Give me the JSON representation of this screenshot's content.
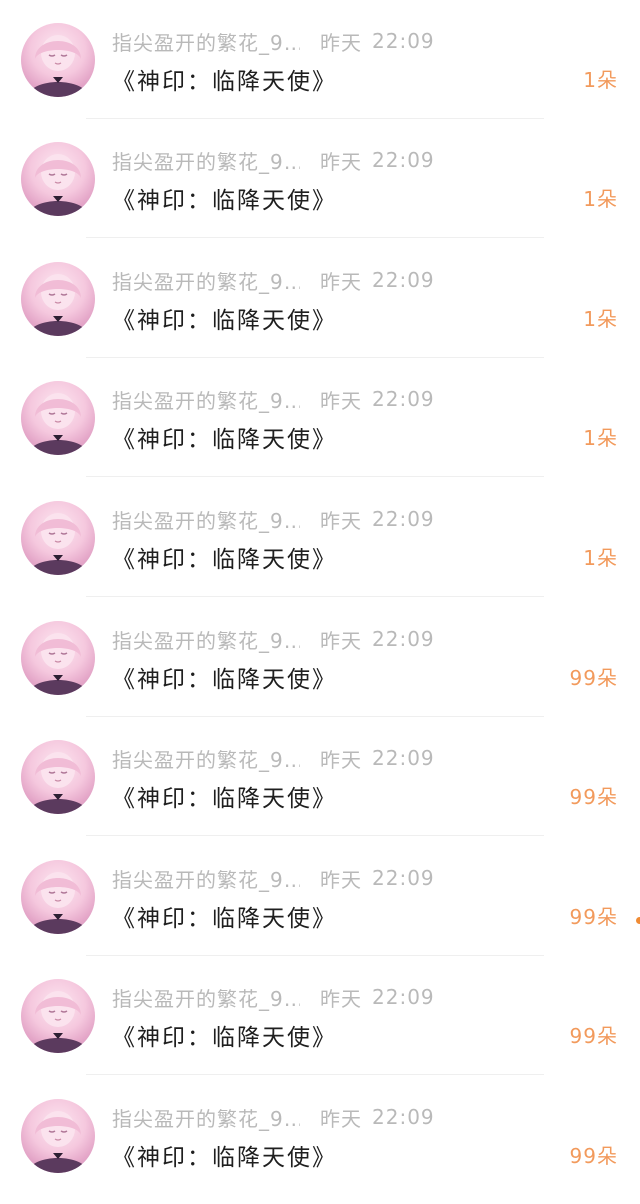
{
  "accent_color": "#f29a5c",
  "items": [
    {
      "sender": "指尖盈开的繁花_9…",
      "time_label": "昨天",
      "time": "22:09",
      "gift": "《神印：临降天使》",
      "count": "1朵"
    },
    {
      "sender": "指尖盈开的繁花_9…",
      "time_label": "昨天",
      "time": "22:09",
      "gift": "《神印：临降天使》",
      "count": "1朵"
    },
    {
      "sender": "指尖盈开的繁花_9…",
      "time_label": "昨天",
      "time": "22:09",
      "gift": "《神印：临降天使》",
      "count": "1朵"
    },
    {
      "sender": "指尖盈开的繁花_9…",
      "time_label": "昨天",
      "time": "22:09",
      "gift": "《神印：临降天使》",
      "count": "1朵"
    },
    {
      "sender": "指尖盈开的繁花_9…",
      "time_label": "昨天",
      "time": "22:09",
      "gift": "《神印：临降天使》",
      "count": "1朵"
    },
    {
      "sender": "指尖盈开的繁花_9…",
      "time_label": "昨天",
      "time": "22:09",
      "gift": "《神印：临降天使》",
      "count": "99朵"
    },
    {
      "sender": "指尖盈开的繁花_9…",
      "time_label": "昨天",
      "time": "22:09",
      "gift": "《神印：临降天使》",
      "count": "99朵"
    },
    {
      "sender": "指尖盈开的繁花_9…",
      "time_label": "昨天",
      "time": "22:09",
      "gift": "《神印：临降天使》",
      "count": "99朵"
    },
    {
      "sender": "指尖盈开的繁花_9…",
      "time_label": "昨天",
      "time": "22:09",
      "gift": "《神印：临降天使》",
      "count": "99朵"
    },
    {
      "sender": "指尖盈开的繁花_9…",
      "time_label": "昨天",
      "time": "22:09",
      "gift": "《神印：临降天使》",
      "count": "99朵"
    }
  ]
}
